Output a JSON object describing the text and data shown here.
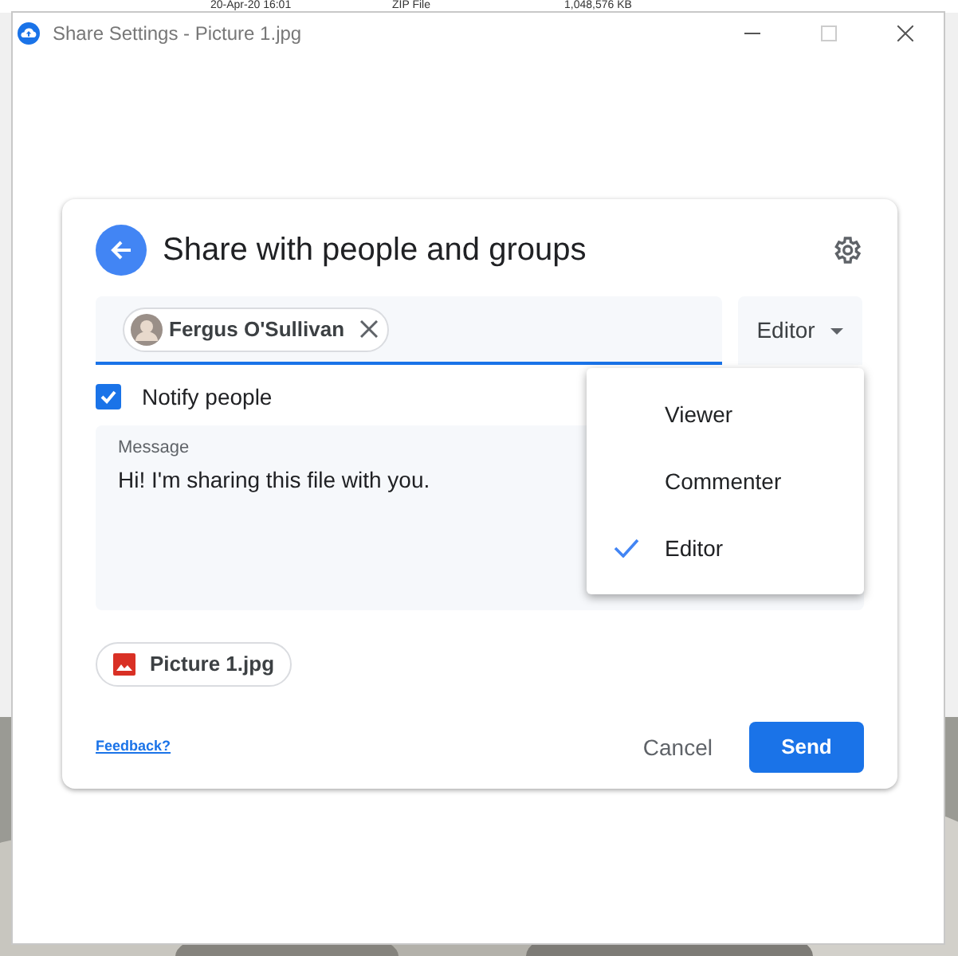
{
  "background_row": {
    "date": "20-Apr-20 16:01",
    "type": "ZIP File",
    "size": "1,048,576 KB"
  },
  "window": {
    "title": "Share Settings - Picture 1.jpg"
  },
  "dialog": {
    "title": "Share with people and groups",
    "recipients": [
      {
        "name": "Fergus O'Sullivan"
      }
    ],
    "role_button": {
      "label": "Editor"
    },
    "notify": {
      "label": "Notify people",
      "checked": true
    },
    "message": {
      "label": "Message",
      "value": "Hi! I'm sharing this file with you."
    },
    "attachment": {
      "name": "Picture 1.jpg"
    },
    "feedback_link": "Feedback?",
    "cancel": "Cancel",
    "send": "Send"
  },
  "role_menu": [
    {
      "label": "Viewer",
      "selected": false
    },
    {
      "label": "Commenter",
      "selected": false
    },
    {
      "label": "Editor",
      "selected": true
    }
  ]
}
